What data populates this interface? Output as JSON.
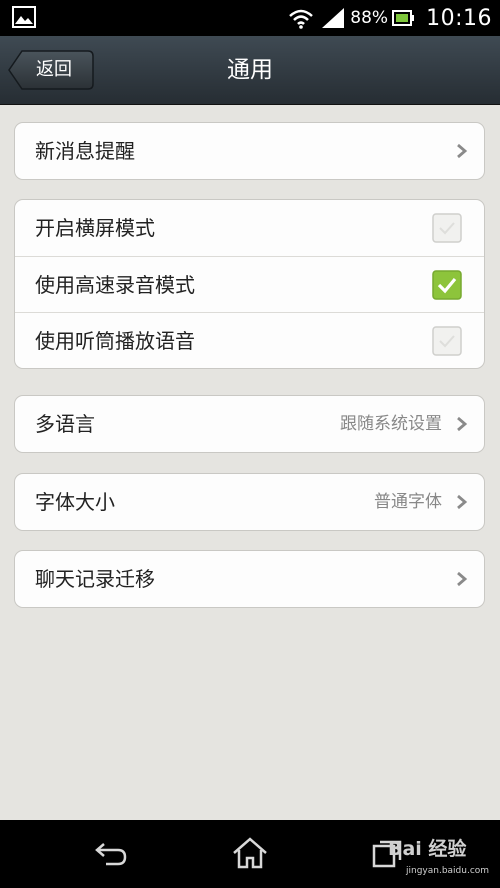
{
  "status_bar": {
    "battery_percent": "88%",
    "time": "10:16",
    "icons": [
      "gallery-icon",
      "wifi-icon",
      "signal-icon",
      "battery-icon"
    ]
  },
  "header": {
    "back_label": "返回",
    "title": "通用"
  },
  "groups": [
    {
      "rows": [
        {
          "label": "新消息提醒",
          "type": "link"
        }
      ]
    },
    {
      "rows": [
        {
          "label": "开启横屏模式",
          "type": "checkbox",
          "checked": false
        },
        {
          "label": "使用高速录音模式",
          "type": "checkbox",
          "checked": true
        },
        {
          "label": "使用听筒播放语音",
          "type": "checkbox",
          "checked": false
        }
      ]
    },
    {
      "rows": [
        {
          "label": "多语言",
          "value": "跟随系统设置",
          "type": "link"
        }
      ]
    },
    {
      "rows": [
        {
          "label": "字体大小",
          "value": "普通字体",
          "type": "link"
        }
      ]
    },
    {
      "rows": [
        {
          "label": "聊天记录迁移",
          "type": "link"
        }
      ]
    }
  ],
  "nav_bar": {
    "icons": [
      "back-icon",
      "home-icon",
      "recent-apps-icon"
    ],
    "watermark": "Bai 经验",
    "watermark_sub": "jingyan.baidu.com"
  },
  "colors": {
    "checkbox_on": "#8dc43b",
    "background": "#e5e4e0"
  }
}
